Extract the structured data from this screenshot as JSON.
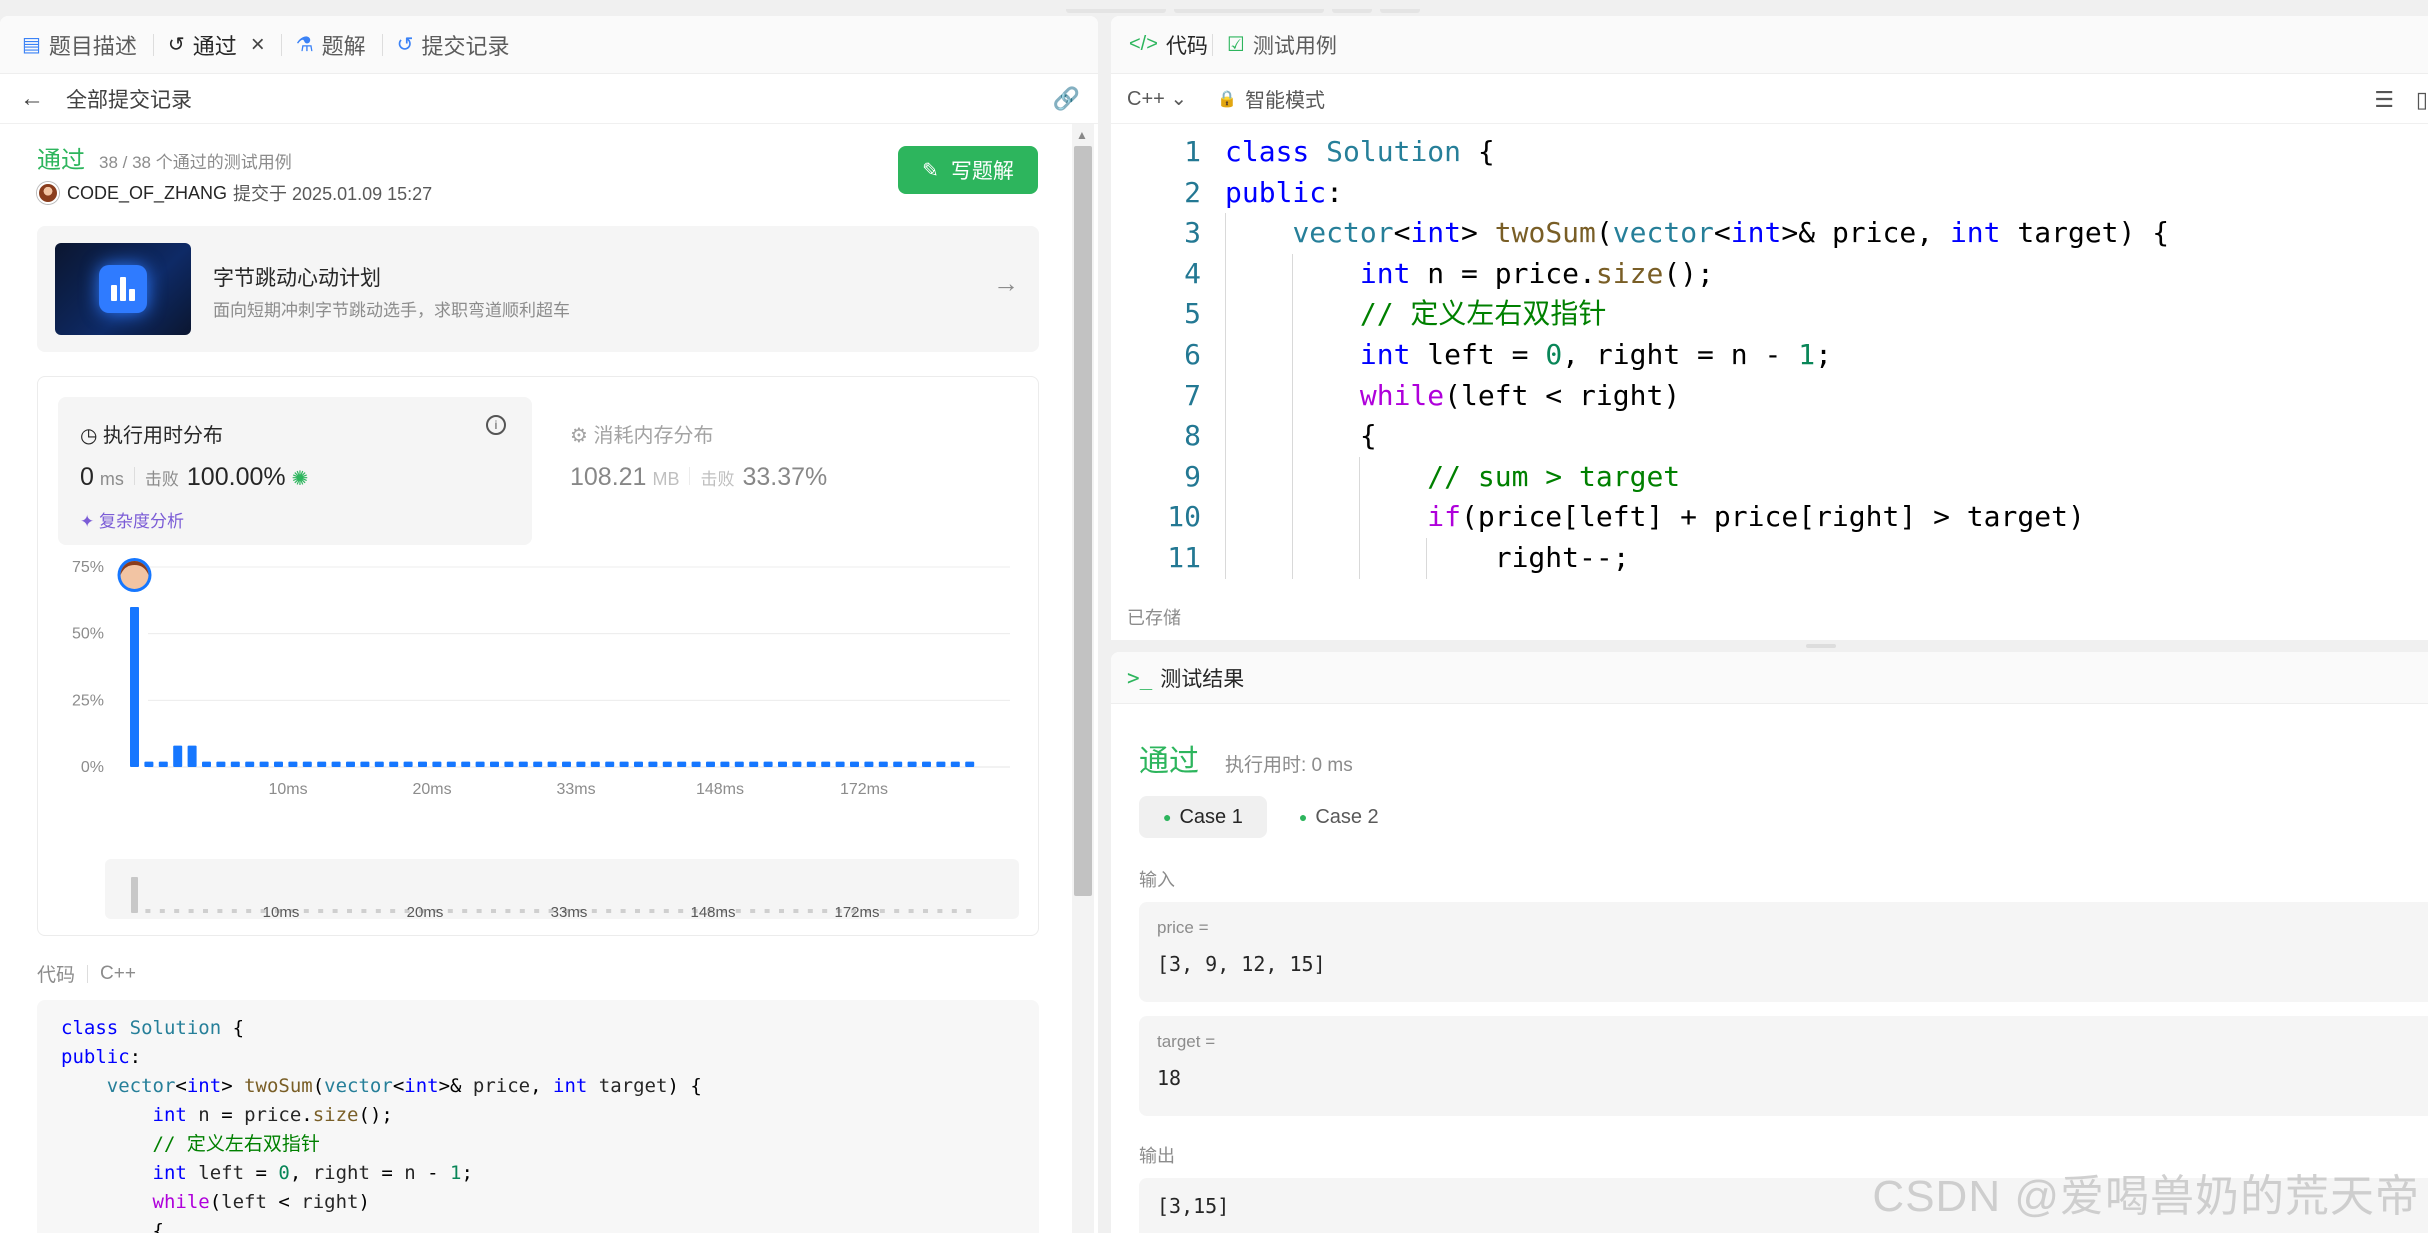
{
  "left_tabs": [
    {
      "label": "题目描述",
      "icon": "description-icon"
    },
    {
      "label": "通过",
      "icon": "history-icon"
    },
    {
      "label": "题解",
      "icon": "flask-icon"
    },
    {
      "label": "提交记录",
      "icon": "history-icon"
    }
  ],
  "back_label": "全部提交记录",
  "submission": {
    "status": "通过",
    "cases": "38 / 38 个通过的测试用例",
    "user": "CODE_OF_ZHANG",
    "submitted": "提交于 2025.01.09 15:27",
    "write_label": "写题解"
  },
  "promo": {
    "title": "字节跳动心动计划",
    "subtitle": "面向短期冲刺字节跳动选手，求职弯道顺利超车"
  },
  "runtime": {
    "title": "执行用时分布",
    "value": "0",
    "unit": "ms",
    "beat_label": "击败",
    "beat": "100.00%",
    "analysis": "复杂度分析"
  },
  "memory": {
    "title": "消耗内存分布",
    "value": "108.21",
    "unit": "MB",
    "beat_label": "击败",
    "beat": "33.37%"
  },
  "chart_data": {
    "type": "bar",
    "ylim": [
      0,
      75
    ],
    "yticks": [
      "75%",
      "50%",
      "25%",
      "0%"
    ],
    "xticks": [
      "10ms",
      "20ms",
      "33ms",
      "148ms",
      "172ms"
    ],
    "values": [
      60,
      2,
      2,
      8,
      8,
      2,
      2,
      2,
      2,
      2,
      2,
      2,
      2,
      2,
      2,
      2,
      2,
      2,
      2,
      2,
      2,
      2,
      2,
      2,
      2,
      2,
      2,
      2,
      2,
      2,
      2,
      2,
      2,
      2,
      2,
      2,
      2,
      2,
      2,
      2,
      2,
      2,
      2,
      2,
      2,
      2,
      2,
      2,
      2,
      2,
      2,
      2,
      2,
      2,
      2,
      2,
      2,
      2,
      2
    ],
    "highlight_index": 0,
    "range_ticks": [
      "10ms",
      "20ms",
      "33ms",
      "148ms",
      "172ms"
    ]
  },
  "code_header": {
    "label": "代码",
    "lang": "C++"
  },
  "code_preview": [
    "class Solution {",
    "public:",
    "    vector<int> twoSum(vector<int>& price, int target) {",
    "        int n = price.size();",
    "        // 定义左右双指针",
    "        int left = 0, right = n - 1;",
    "        while(left < right)",
    "        {"
  ],
  "right_tabs": [
    {
      "label": "代码",
      "icon": "code-icon"
    },
    {
      "label": "测试用例",
      "icon": "checkbox-icon"
    }
  ],
  "editor": {
    "lang": "C++",
    "mode": "智能模式",
    "saved": "已存储"
  },
  "result": {
    "header": "测试结果",
    "status": "通过",
    "runtime": "执行用时: 0 ms",
    "cases": [
      "Case 1",
      "Case 2"
    ],
    "input_label": "输入",
    "output_label": "输出",
    "inputs": [
      {
        "key": "price =",
        "value": "[3, 9, 12, 15]"
      },
      {
        "key": "target =",
        "value": "18"
      }
    ],
    "output": "[3,15]"
  },
  "watermark": "CSDN @爱喝兽奶的荒天帝"
}
